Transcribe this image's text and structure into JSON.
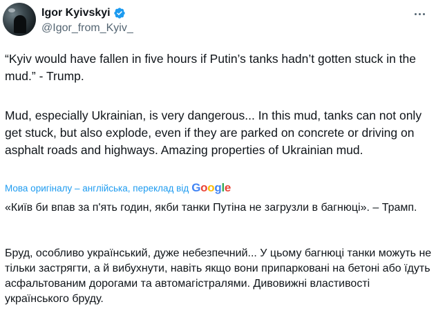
{
  "tweet": {
    "author": {
      "display_name": "Igor Kyivskyi",
      "handle": "@Igor_from_Kyiv_",
      "verified": true
    },
    "more_icon": "more-horizontal-icon",
    "original_paragraphs": [
      "“Kyiv would have fallen in five hours if Putin’s tanks hadn’t gotten stuck in the mud.” - Trump.",
      "Mud, especially Ukrainian, is very dangerous... In this mud, tanks can not only get stuck, but also explode, even if they are parked on concrete or driving on asphalt roads and highways. Amazing properties of Ukrainian mud."
    ],
    "translation": {
      "label": "Мова оригіналу – англійська, переклад від",
      "provider": "Google",
      "paragraphs": [
        "«Київ би впав за п'ять годин, якби танки Путіна не загрузли в багнюці». – Трамп.",
        "Бруд, особливо український, дуже небезпечний... У цьому багнюці танки можуть не тільки застрягти, а й вибухнути, навіть якщо вони припарковані на бетоні або їдуть асфальтованим дорогами та автомагістралями. Дивовижні властивості українського бруду."
      ]
    }
  },
  "colors": {
    "text": "#0f1419",
    "secondary": "#536471",
    "accent": "#1d9bf0",
    "google_blue": "#4285f4",
    "google_red": "#ea4335",
    "google_yellow": "#fbbc05",
    "google_green": "#34a853"
  }
}
